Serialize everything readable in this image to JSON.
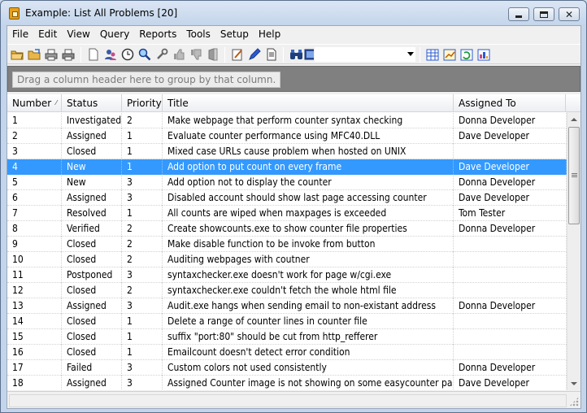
{
  "window": {
    "title": "Example: List All Problems [20]"
  },
  "menu": {
    "items": [
      {
        "label": "File"
      },
      {
        "label": "Edit"
      },
      {
        "label": "View"
      },
      {
        "label": "Query"
      },
      {
        "label": "Reports"
      },
      {
        "label": "Tools"
      },
      {
        "label": "Setup"
      },
      {
        "label": "Help"
      }
    ]
  },
  "toolbar": {
    "icons": [
      "open-folder-icon",
      "open-file-icon",
      "print-icon",
      "print-preview-icon",
      "new-document-icon",
      "users-icon",
      "clock-icon",
      "find-icon",
      "tools-icon",
      "thumbs-up-icon",
      "thumbs-down-icon",
      "archive-icon",
      "edit-icon",
      "pen-icon",
      "page-icon",
      "binoculars-icon",
      "view-icon",
      "grid-icon",
      "chart-icon",
      "refresh-grid-icon",
      "report-icon"
    ],
    "combo_value": ""
  },
  "groupbar": {
    "hint": "Drag a column header here to group by that column."
  },
  "grid": {
    "columns": [
      {
        "label": "Number"
      },
      {
        "label": "Status"
      },
      {
        "label": "Priority"
      },
      {
        "label": "Title"
      },
      {
        "label": "Assigned To"
      }
    ],
    "sort_column": "Number",
    "sort_direction": "ascending",
    "selected_row_number": "4",
    "rows": [
      {
        "number": "1",
        "status": "Investigated",
        "priority": "2",
        "title": "Make webpage that perform counter syntax checking",
        "assigned_to": "Donna Developer"
      },
      {
        "number": "2",
        "status": "Assigned",
        "priority": "1",
        "title": "Evaluate counter performance using MFC40.DLL",
        "assigned_to": "Dave Developer"
      },
      {
        "number": "3",
        "status": "Closed",
        "priority": "1",
        "title": "Mixed case URLs cause problem when hosted on UNIX",
        "assigned_to": ""
      },
      {
        "number": "4",
        "status": "New",
        "priority": "1",
        "title": "Add option to put count on every frame",
        "assigned_to": "Dave Developer"
      },
      {
        "number": "5",
        "status": "New",
        "priority": "3",
        "title": "Add option not to display the counter",
        "assigned_to": "Donna Developer"
      },
      {
        "number": "6",
        "status": "Assigned",
        "priority": "3",
        "title": "Disabled account should show last page accessing counter",
        "assigned_to": "Dave Developer"
      },
      {
        "number": "7",
        "status": "Resolved",
        "priority": "1",
        "title": "All counts are wiped when maxpages is exceeded",
        "assigned_to": "Tom Tester"
      },
      {
        "number": "8",
        "status": "Verified",
        "priority": "2",
        "title": "Create showcounts.exe to show counter file properties",
        "assigned_to": "Donna Developer"
      },
      {
        "number": "9",
        "status": "Closed",
        "priority": "2",
        "title": "Make disable function to be invoke from button",
        "assigned_to": ""
      },
      {
        "number": "10",
        "status": "Closed",
        "priority": "2",
        "title": "Auditing webpages with coutner",
        "assigned_to": ""
      },
      {
        "number": "11",
        "status": "Postponed",
        "priority": "3",
        "title": "syntaxchecker.exe doesn't work for page w/cgi.exe",
        "assigned_to": ""
      },
      {
        "number": "12",
        "status": "Closed",
        "priority": "2",
        "title": "syntaxchecker.exe couldn't fetch the whole html file",
        "assigned_to": ""
      },
      {
        "number": "13",
        "status": "Assigned",
        "priority": "3",
        "title": "Audit.exe hangs when sending email to non-existant address",
        "assigned_to": "Donna Developer"
      },
      {
        "number": "14",
        "status": "Closed",
        "priority": "1",
        "title": "Delete a range of counter lines in counter file",
        "assigned_to": ""
      },
      {
        "number": "15",
        "status": "Closed",
        "priority": "1",
        "title": "suffix \"port:80\" should be cut from http_refferer",
        "assigned_to": ""
      },
      {
        "number": "16",
        "status": "Closed",
        "priority": "1",
        "title": "Emailcount doesn't detect error condition",
        "assigned_to": ""
      },
      {
        "number": "17",
        "status": "Failed",
        "priority": "3",
        "title": "Custom colors not used consistently",
        "assigned_to": "Donna Developer"
      },
      {
        "number": "18",
        "status": "Assigned",
        "priority": "3",
        "title": "Assigned Counter image is not showing on some easycounter pages",
        "assigned_to": "Dave Developer"
      }
    ]
  },
  "status": {
    "text": ""
  }
}
